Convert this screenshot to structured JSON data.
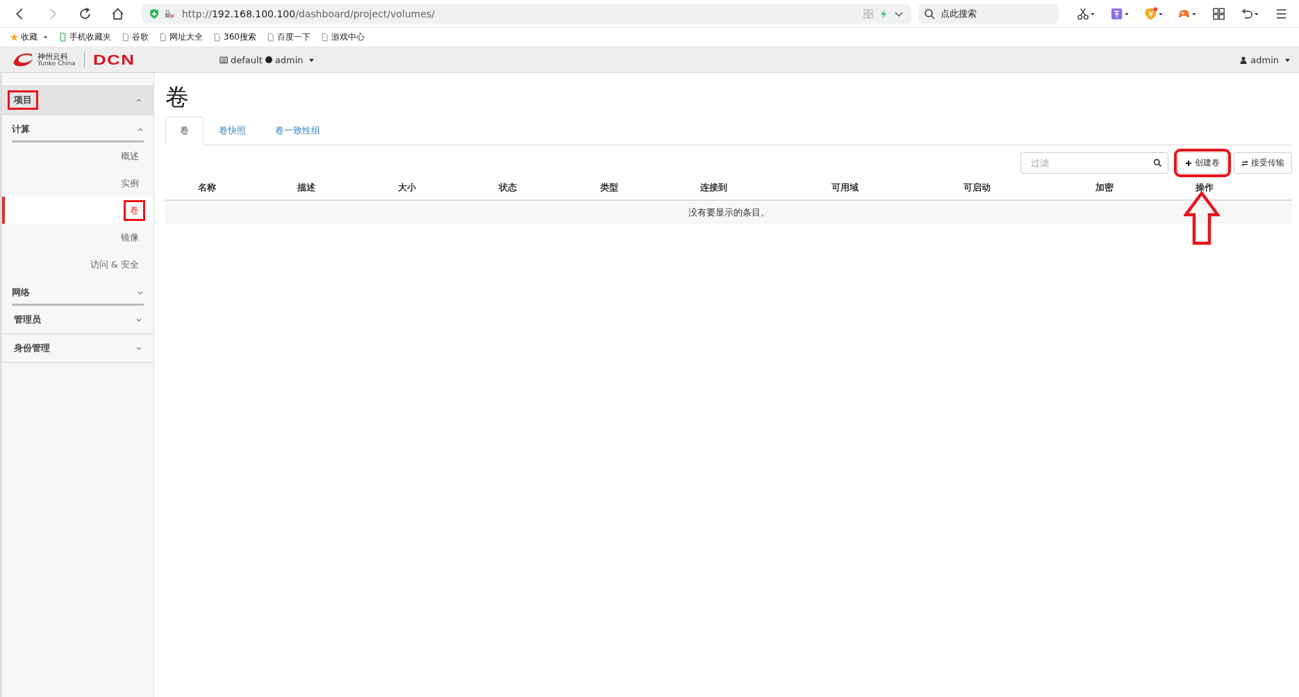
{
  "browser": {
    "url": {
      "scheme": "http://",
      "host": "192.168.100.100",
      "path": "/dashboard/project/volumes/"
    },
    "search": {
      "placeholder": "点此搜索"
    }
  },
  "bookmarks": [
    {
      "label": "收藏",
      "kind": "star"
    },
    {
      "label": "手机收藏夹",
      "kind": "phone"
    },
    {
      "label": "谷歌",
      "kind": "page"
    },
    {
      "label": "网址大全",
      "kind": "page"
    },
    {
      "label": "360搜索",
      "kind": "page"
    },
    {
      "label": "百度一下",
      "kind": "page"
    },
    {
      "label": "游戏中心",
      "kind": "page"
    }
  ],
  "header": {
    "logo": {
      "cn": "神州云科",
      "en": "Yunke China",
      "brand": "DCN"
    },
    "project": "default",
    "project_user": "admin",
    "user": "admin"
  },
  "sidebar": [
    {
      "label": "项目",
      "expanded": true,
      "highlighted": true,
      "children": [
        {
          "label": "计算",
          "expanded": true,
          "children": [
            {
              "label": "概述",
              "selected": false,
              "highlighted": false
            },
            {
              "label": "实例",
              "selected": false,
              "highlighted": false
            },
            {
              "label": "卷",
              "selected": true,
              "highlighted": true
            },
            {
              "label": "镜像",
              "selected": false,
              "highlighted": false
            },
            {
              "label": "访问 & 安全",
              "selected": false,
              "highlighted": false
            }
          ]
        },
        {
          "label": "网络",
          "expanded": false
        }
      ]
    },
    {
      "label": "管理员",
      "expanded": false,
      "highlighted": false
    },
    {
      "label": "身份管理",
      "expanded": false,
      "highlighted": false
    }
  ],
  "page_title": "卷",
  "tabs": [
    {
      "label": "卷",
      "selected": true
    },
    {
      "label": "卷快照",
      "selected": false
    },
    {
      "label": "卷一致性组",
      "selected": false
    }
  ],
  "filter": {
    "placeholder": "过滤"
  },
  "buttons": [
    {
      "label": "创建卷",
      "kind": "create",
      "highlighted": true
    },
    {
      "label": "接受传输",
      "kind": "transfer",
      "highlighted": false
    }
  ],
  "table": {
    "columns": [
      "名称",
      "描述",
      "大小",
      "状态",
      "类型",
      "连接到",
      "可用域",
      "可启动",
      "加密",
      "操作"
    ],
    "empty_message": "没有要显示的条目。"
  }
}
